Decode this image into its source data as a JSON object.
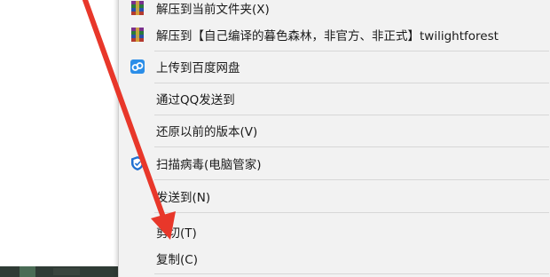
{
  "menu": {
    "items": [
      {
        "label": "解压到当前文件夹(X)",
        "icon": "winrar-icon"
      },
      {
        "label": "解压到【自己编译的暮色森林，非官方、非正式】twilightforest",
        "icon": "winrar-icon"
      },
      {
        "label": "上传到百度网盘",
        "icon": "baidu-netdisk-icon"
      },
      {
        "label": "通过QQ发送到",
        "icon": ""
      },
      {
        "label": "还原以前的版本(V)",
        "icon": ""
      },
      {
        "label": "扫描病毒(电脑管家)",
        "icon": "tencent-pcmgr-icon"
      },
      {
        "label": "发送到(N)",
        "icon": ""
      },
      {
        "label": "剪切(T)",
        "icon": ""
      },
      {
        "label": "复制(C)",
        "icon": ""
      }
    ]
  },
  "colors": {
    "menu_bg": "#f2f2f2",
    "annotation_arrow": "#e8372a",
    "baidu_blue": "#2b8ee8",
    "pcmgr_blue": "#1f6fd1"
  }
}
